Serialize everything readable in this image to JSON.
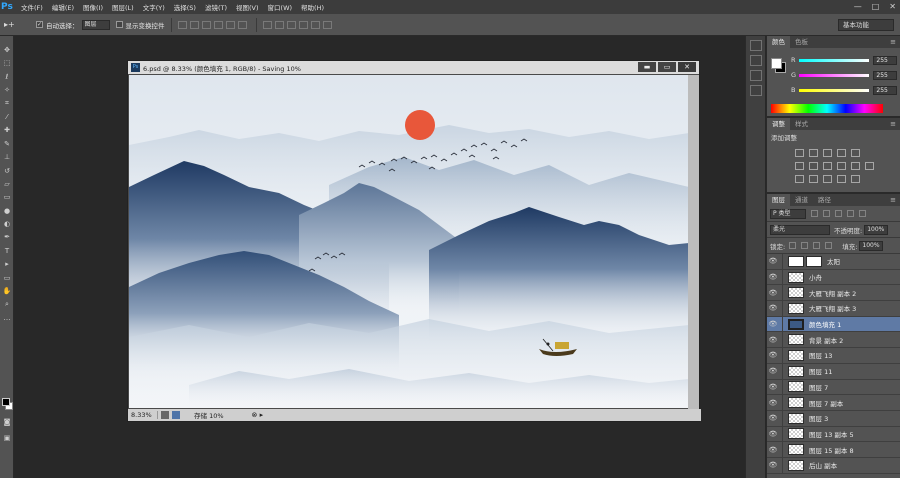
{
  "app": {
    "logo": "Ps"
  },
  "menu": [
    "文件(F)",
    "编辑(E)",
    "图像(I)",
    "图层(L)",
    "文字(Y)",
    "选择(S)",
    "滤镜(T)",
    "视图(V)",
    "窗口(W)",
    "帮助(H)"
  ],
  "window_controls": {
    "minimize": "—",
    "maximize": "□",
    "close": "✕"
  },
  "options_bar": {
    "tool_glyph": "▸+",
    "auto_select_label": "自动选择：",
    "auto_select_value": "图层",
    "show_transform_label": "显示变换控件",
    "workspace": "基本功能"
  },
  "document": {
    "title": "6.psd @ 8.33% (颜色填充 1, RGB/8) - Saving 10%",
    "zoom": "8.33%",
    "status": "存储 10%",
    "status_arrows": "⊗ ▸",
    "controls": {
      "minimize": "▬",
      "restore": "▭",
      "close": "✕"
    }
  },
  "color_panel": {
    "tabs": [
      "颜色",
      "色板"
    ],
    "channels": [
      {
        "name": "R",
        "value": "255",
        "gradient": [
          "#00ffff",
          "#ffffff"
        ]
      },
      {
        "name": "G",
        "value": "255",
        "gradient": [
          "#ff00ff",
          "#ffffff"
        ]
      },
      {
        "name": "B",
        "value": "255",
        "gradient": [
          "#ffff00",
          "#ffffff"
        ]
      }
    ]
  },
  "adjustments_panel": {
    "tabs": [
      "调整",
      "样式"
    ],
    "title": "添加调整"
  },
  "layers_panel": {
    "tabs": [
      "图层",
      "通道",
      "路径"
    ],
    "filter_kind": "P 类型",
    "blend_mode": "柔光",
    "opacity_label": "不透明度:",
    "opacity_value": "100%",
    "lock_label": "锁定:",
    "fill_label": "填充:",
    "fill_value": "100%",
    "layers": [
      {
        "name": "太阳",
        "thumb": "white",
        "mask": true,
        "selected": false
      },
      {
        "name": "小舟",
        "thumb": "checker",
        "mask": false,
        "selected": false
      },
      {
        "name": "大雁飞翔 副本 2",
        "thumb": "checker",
        "mask": false,
        "selected": false
      },
      {
        "name": "大雁飞翔 副本 3",
        "thumb": "checker",
        "mask": false,
        "selected": false
      },
      {
        "name": "颜色填充 1",
        "thumb": "blue",
        "mask": false,
        "selected": true
      },
      {
        "name": "背景 副本 2",
        "thumb": "checker",
        "mask": false,
        "selected": false
      },
      {
        "name": "图层 13",
        "thumb": "checker",
        "mask": false,
        "selected": false
      },
      {
        "name": "图层 11",
        "thumb": "checker",
        "mask": false,
        "selected": false
      },
      {
        "name": "图层 7",
        "thumb": "checker",
        "mask": false,
        "selected": false
      },
      {
        "name": "图层 7 副本",
        "thumb": "checker",
        "mask": false,
        "selected": false
      },
      {
        "name": "图层 3",
        "thumb": "checker",
        "mask": false,
        "selected": false
      },
      {
        "name": "图层 13 副本 5",
        "thumb": "checker",
        "mask": false,
        "selected": false
      },
      {
        "name": "图层 15 副本 8",
        "thumb": "checker",
        "mask": false,
        "selected": false
      },
      {
        "name": "后山 副本",
        "thumb": "checker",
        "mask": false,
        "selected": false
      }
    ]
  },
  "colors": {
    "sun": "#e8573a",
    "mountain_dark": "#2c4770",
    "sky_top": "#e3eaf1",
    "selection": "#5f7aa5"
  }
}
